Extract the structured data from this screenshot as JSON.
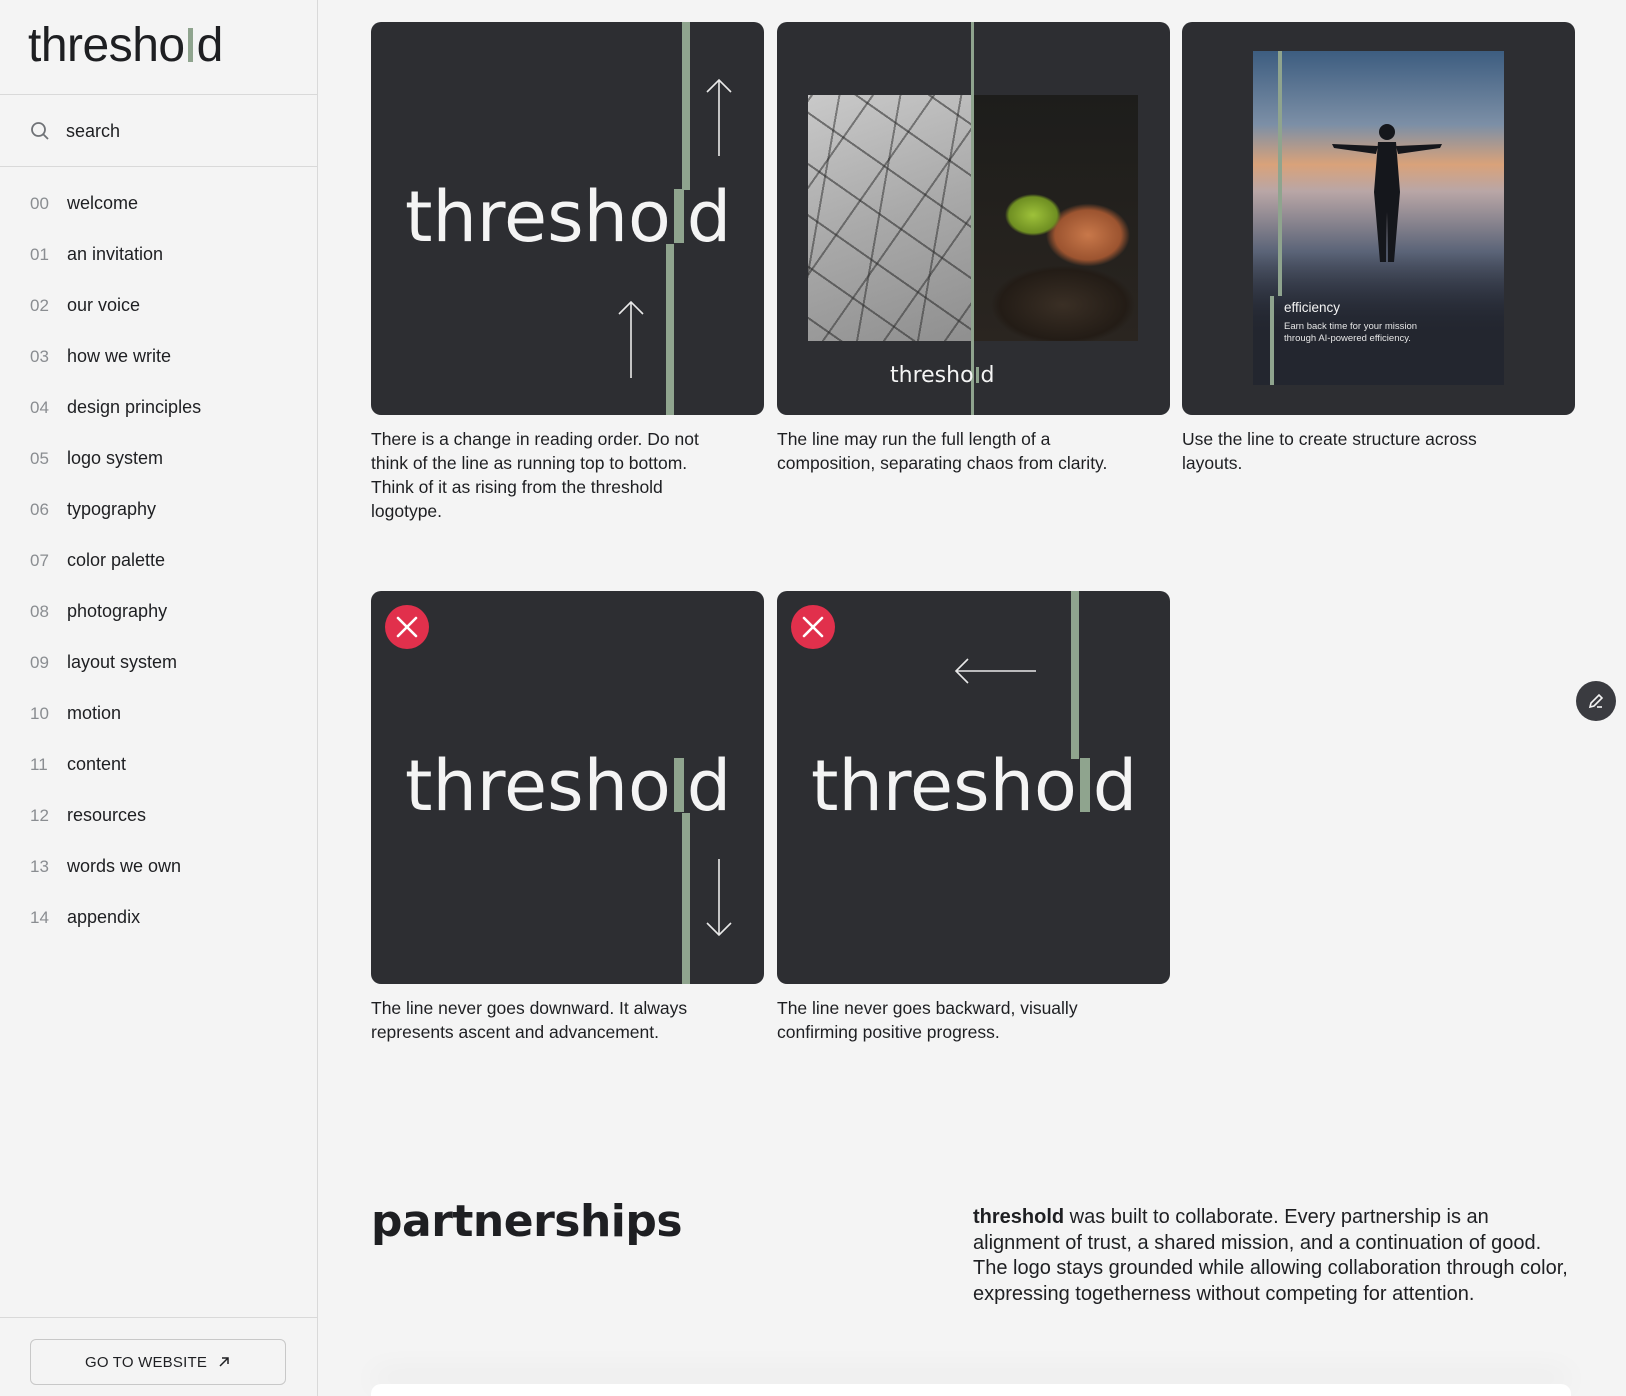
{
  "brand": {
    "wordmark_left": "thresho",
    "wordmark_right": "d",
    "accent": "#8fa48e"
  },
  "search": {
    "placeholder": "search"
  },
  "nav": [
    {
      "num": "00",
      "label": "welcome"
    },
    {
      "num": "01",
      "label": "an invitation"
    },
    {
      "num": "02",
      "label": "our voice"
    },
    {
      "num": "03",
      "label": "how we write"
    },
    {
      "num": "04",
      "label": "design principles"
    },
    {
      "num": "05",
      "label": "logo system"
    },
    {
      "num": "06",
      "label": "typography"
    },
    {
      "num": "07",
      "label": "color palette"
    },
    {
      "num": "08",
      "label": "photography"
    },
    {
      "num": "09",
      "label": "layout system"
    },
    {
      "num": "10",
      "label": "motion"
    },
    {
      "num": "11",
      "label": "content"
    },
    {
      "num": "12",
      "label": "resources"
    },
    {
      "num": "13",
      "label": "words we own"
    },
    {
      "num": "14",
      "label": "appendix"
    }
  ],
  "go_button": {
    "label": "GO TO WEBSITE"
  },
  "cards": {
    "c1": {
      "wm_left": "thresho",
      "wm_right": "d",
      "caption": "There is a change in reading order. Do not think of the line as running top to bottom. Think of it as rising from the threshold logotype."
    },
    "c2": {
      "wm_left": "thresho",
      "wm_right": "d",
      "caption": "The line may run the full length of a composition, separating chaos from clarity."
    },
    "c3": {
      "overlay_title": "efficiency",
      "overlay_text": "Earn back time for your mission through AI-powered efficiency.",
      "caption": "Use the line to create structure across layouts."
    },
    "c4": {
      "wm_left": "thresho",
      "wm_right": "d",
      "caption": "The line never goes downward. It always represents ascent and advancement."
    },
    "c5": {
      "wm_left": "thresho",
      "wm_right": "d",
      "caption": "The line never goes backward, visually confirming positive progress."
    }
  },
  "partnerships": {
    "title": "partnerships",
    "body_bold": "threshold",
    "body": " was built to collaborate. Every partnership is an alignment of trust, a shared mission, and a continuation of good. The logo stays grounded while allowing collaboration through color, expressing togetherness without competing for attention."
  },
  "colors": {
    "card_bg": "#2d2e32",
    "error": "#e1304c",
    "page_bg": "#f4f4f4"
  },
  "icons": [
    "search-icon",
    "arrow-up-icon",
    "arrow-down-icon",
    "arrow-left-icon",
    "close-icon",
    "external-arrow-icon",
    "edit-pencil-icon"
  ]
}
